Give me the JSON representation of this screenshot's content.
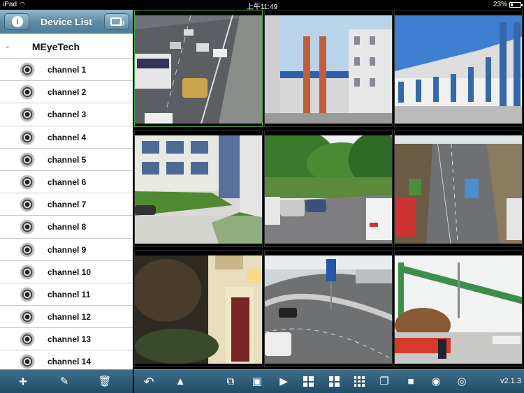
{
  "status_bar": {
    "carrier": "iPad",
    "time": "上午11:49",
    "battery": "23%",
    "battery_level": 0.23
  },
  "sidebar": {
    "title": "Device List",
    "group_name": "MEyeTech",
    "channels": [
      {
        "label": "channel 1"
      },
      {
        "label": "channel 2"
      },
      {
        "label": "channel 3"
      },
      {
        "label": "channel 4"
      },
      {
        "label": "channel 5"
      },
      {
        "label": "channel 6"
      },
      {
        "label": "channel 7"
      },
      {
        "label": "channel 8"
      },
      {
        "label": "channel 9"
      },
      {
        "label": "channel 10"
      },
      {
        "label": "channel 11"
      },
      {
        "label": "channel 12"
      },
      {
        "label": "channel 13"
      },
      {
        "label": "channel 14"
      }
    ],
    "toolbar_icons": [
      "add-icon",
      "edit-icon",
      "delete-icon"
    ]
  },
  "video_grid": {
    "layout": "3x3",
    "selected_cell": 1,
    "feeds": [
      "highway-traffic",
      "building-courtyard",
      "apartment-blocks",
      "office-building",
      "tree-lined-street",
      "highway-cutting",
      "house-entrance",
      "curved-expressway",
      "road-gantry"
    ]
  },
  "main_toolbar": {
    "icons": [
      "back-icon",
      "ptz-icon",
      "split-screen-icon",
      "close-view-icon",
      "play-icon",
      "grid-4-icon",
      "grid-6-icon",
      "grid-9-icon",
      "fullscreen-icon",
      "record-icon",
      "playback-icon",
      "remote-playback-icon"
    ],
    "version": "v2.1.3"
  },
  "colors": {
    "toolbar": "#2b5a76",
    "header": "#5d8aa4",
    "selected_border": "#3fae3f"
  }
}
